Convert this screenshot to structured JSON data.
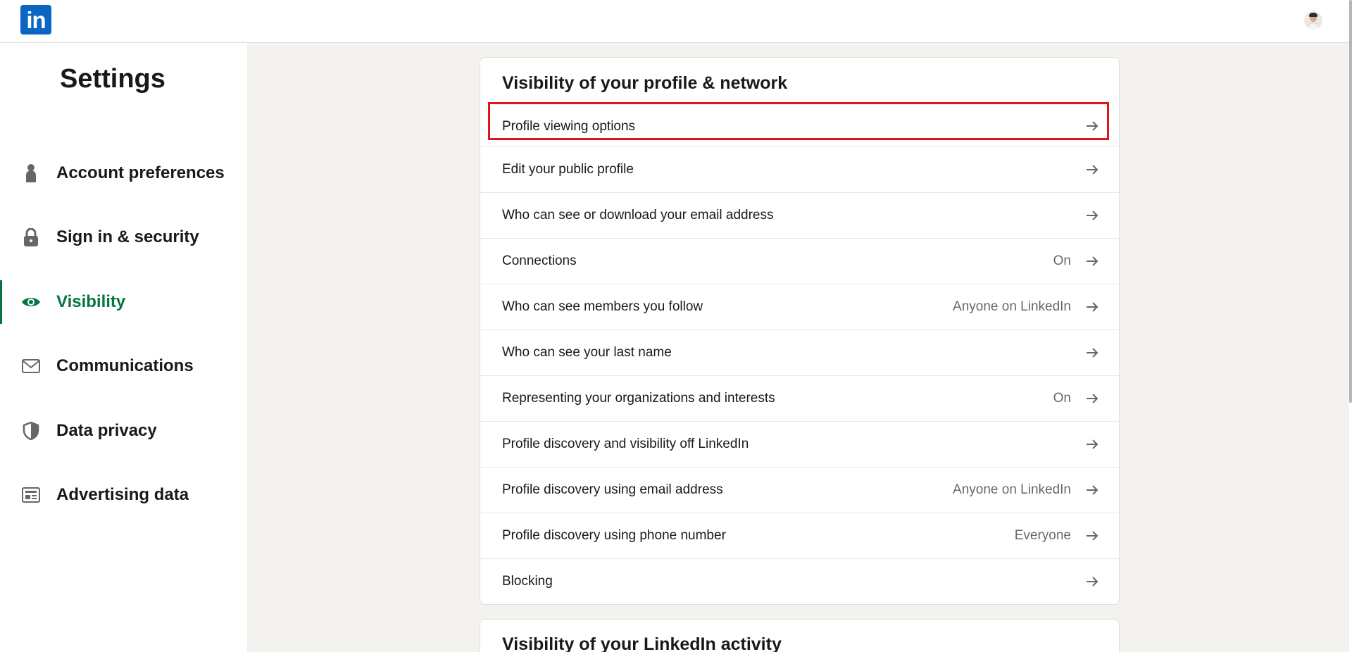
{
  "header": {
    "logo_text": "in",
    "brand_color": "#0a66c2"
  },
  "sidebar": {
    "title": "Settings",
    "active_color": "#057642",
    "items": [
      {
        "label": "Account preferences",
        "icon": "person-icon"
      },
      {
        "label": "Sign in & security",
        "icon": "lock-icon"
      },
      {
        "label": "Visibility",
        "icon": "eye-icon",
        "active": true
      },
      {
        "label": "Communications",
        "icon": "envelope-icon"
      },
      {
        "label": "Data privacy",
        "icon": "shield-icon"
      },
      {
        "label": "Advertising data",
        "icon": "ad-newspaper-icon"
      }
    ]
  },
  "main": {
    "section_title": "Visibility of your profile & network",
    "rows": [
      {
        "label": "Profile viewing options",
        "value": "",
        "highlighted": true
      },
      {
        "label": "Edit your public profile",
        "value": ""
      },
      {
        "label": "Who can see or download your email address",
        "value": ""
      },
      {
        "label": "Connections",
        "value": "On"
      },
      {
        "label": "Who can see members you follow",
        "value": "Anyone on LinkedIn"
      },
      {
        "label": "Who can see your last name",
        "value": ""
      },
      {
        "label": "Representing your organizations and interests",
        "value": "On"
      },
      {
        "label": "Profile discovery and visibility off LinkedIn",
        "value": ""
      },
      {
        "label": "Profile discovery using email address",
        "value": "Anyone on LinkedIn"
      },
      {
        "label": "Profile discovery using phone number",
        "value": "Everyone"
      },
      {
        "label": "Blocking",
        "value": ""
      }
    ],
    "next_section_title": "Visibility of your LinkedIn activity",
    "highlight_color": "#e0151b"
  }
}
